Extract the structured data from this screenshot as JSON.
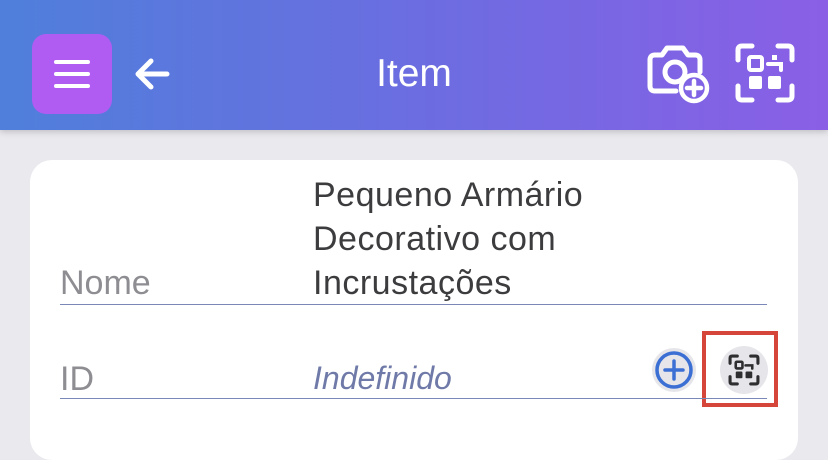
{
  "header": {
    "title": "Item",
    "icons": {
      "menu": "hamburger-menu-icon",
      "back": "arrow-left-icon",
      "camera": "camera-add-icon",
      "scan": "qr-scan-icon"
    },
    "colors": {
      "gradient_start": "#4f7fdb",
      "gradient_end": "#8a5fe6",
      "menu_button": "#b05cf3"
    }
  },
  "fields": {
    "name": {
      "label": "Nome",
      "value": "Pequeno Armário Decorativo com Incrustações"
    },
    "id": {
      "label": "ID",
      "value": "Indefinido",
      "icons": {
        "add": "plus-circle-icon",
        "scan": "qr-scan-icon"
      }
    }
  },
  "highlight_color": "#d6453a"
}
